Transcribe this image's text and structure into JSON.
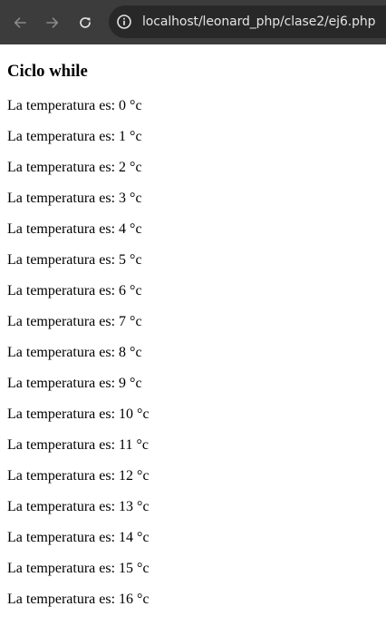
{
  "browser": {
    "url": "localhost/leonard_php/clase2/ej6.php",
    "theme_color": "#3c3c3c",
    "omnibox_color": "#282828"
  },
  "page": {
    "title": "Ciclo while",
    "lines": [
      "La temperatura es: 0 °c",
      "La temperatura es: 1 °c",
      "La temperatura es: 2 °c",
      "La temperatura es: 3 °c",
      "La temperatura es: 4 °c",
      "La temperatura es: 5 °c",
      "La temperatura es: 6 °c",
      "La temperatura es: 7 °c",
      "La temperatura es: 8 °c",
      "La temperatura es: 9 °c",
      "La temperatura es: 10 °c",
      "La temperatura es: 11 °c",
      "La temperatura es: 12 °c",
      "La temperatura es: 13 °c",
      "La temperatura es: 14 °c",
      "La temperatura es: 15 °c",
      "La temperatura es: 16 °c"
    ]
  }
}
